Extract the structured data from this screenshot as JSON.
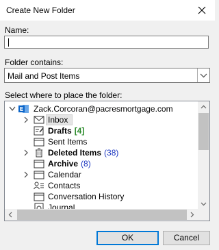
{
  "dialog": {
    "title": "Create New Folder",
    "name_label": "Name:",
    "name_value": "",
    "contains_label": "Folder contains:",
    "contains_value": "Mail and Post Items",
    "place_label": "Select where to place the folder:",
    "ok_label": "OK",
    "cancel_label": "Cancel"
  },
  "tree": {
    "account": "Zack.Corcoran@pacresmortgage.com",
    "items": [
      {
        "label": "Inbox",
        "count": "",
        "icon": "envelope-icon",
        "selected": true,
        "bold": false
      },
      {
        "label": "Drafts",
        "count": "[4]",
        "icon": "drafts-icon",
        "selected": false,
        "bold": true
      },
      {
        "label": "Sent Items",
        "count": "",
        "icon": "folder-icon",
        "selected": false,
        "bold": false
      },
      {
        "label": "Deleted Items",
        "count": "(38)",
        "icon": "trash-icon",
        "selected": false,
        "bold": true
      },
      {
        "label": "Archive",
        "count": "(8)",
        "icon": "folder-icon",
        "selected": false,
        "bold": true
      },
      {
        "label": "Calendar",
        "count": "",
        "icon": "calendar-icon",
        "selected": false,
        "bold": false
      },
      {
        "label": "Contacts",
        "count": "",
        "icon": "contacts-icon",
        "selected": false,
        "bold": false
      },
      {
        "label": "Conversation History",
        "count": "",
        "icon": "folder-icon",
        "selected": false,
        "bold": false
      },
      {
        "label": "Journal",
        "count": "",
        "icon": "journal-icon",
        "selected": false,
        "bold": false
      }
    ]
  },
  "colors": {
    "accent": "#0078d7",
    "count_blue": "#1a35c0",
    "count_green": "#2a8a2a",
    "account_icon": "#0a64c8"
  }
}
